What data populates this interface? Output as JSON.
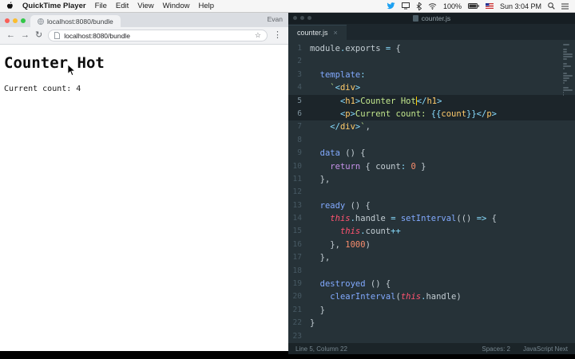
{
  "menu_bar": {
    "app_name": "QuickTime Player",
    "menus": [
      "File",
      "Edit",
      "View",
      "Window",
      "Help"
    ],
    "status": {
      "battery_percent": "100%",
      "clock": "Sun 3:04 PM"
    }
  },
  "browser": {
    "tab_title": "localhost:8080/bundle",
    "profile_name": "Evan",
    "url": "localhost:8080/bundle",
    "page": {
      "heading": "Counter Hot",
      "count_text": "Current count: 4"
    }
  },
  "editor": {
    "window_title": "counter.js",
    "tab": {
      "title": "counter.js"
    },
    "status_bar": {
      "position": "Line 5, Column 22",
      "indent": "Spaces: 2",
      "syntax": "JavaScript Next"
    },
    "code": {
      "lines": [
        {
          "n": 1,
          "hl": false,
          "t": [
            [
              "pl",
              "module"
            ],
            [
              "pn",
              "."
            ],
            [
              "pl",
              "exports "
            ],
            [
              "pn",
              "="
            ],
            [
              "pl",
              " {"
            ]
          ]
        },
        {
          "n": 2,
          "hl": false,
          "t": []
        },
        {
          "n": 3,
          "hl": false,
          "t": [
            [
              "fn",
              "  template"
            ],
            [
              "pn",
              ":"
            ]
          ]
        },
        {
          "n": 4,
          "hl": false,
          "t": [
            [
              "str",
              "    `"
            ],
            [
              "pn",
              "<"
            ],
            [
              "tag",
              "div"
            ],
            [
              "pn",
              ">"
            ]
          ]
        },
        {
          "n": 5,
          "hl": true,
          "t": [
            [
              "str",
              "      "
            ],
            [
              "pn",
              "<"
            ],
            [
              "tag",
              "h1"
            ],
            [
              "pn",
              ">"
            ],
            [
              "str",
              "Counter Hot"
            ],
            [
              "crt",
              ""
            ],
            [
              "pn",
              "</"
            ],
            [
              "tag",
              "h1"
            ],
            [
              "pn",
              ">"
            ]
          ]
        },
        {
          "n": 6,
          "hl": true,
          "t": [
            [
              "str",
              "      "
            ],
            [
              "pn",
              "<"
            ],
            [
              "tag",
              "p"
            ],
            [
              "pn",
              ">"
            ],
            [
              "str",
              "Current count: "
            ],
            [
              "pn",
              "{{"
            ],
            [
              "tag",
              "count"
            ],
            [
              "pn",
              "}}"
            ],
            [
              "pn",
              "</"
            ],
            [
              "tag",
              "p"
            ],
            [
              "pn",
              ">"
            ]
          ]
        },
        {
          "n": 7,
          "hl": false,
          "t": [
            [
              "str",
              "    "
            ],
            [
              "pn",
              "</"
            ],
            [
              "tag",
              "div"
            ],
            [
              "pn",
              ">"
            ],
            [
              "str",
              "`"
            ],
            [
              "pl",
              ","
            ]
          ]
        },
        {
          "n": 8,
          "hl": false,
          "t": []
        },
        {
          "n": 9,
          "hl": false,
          "t": [
            [
              "fn",
              "  data"
            ],
            [
              "pl",
              " () {"
            ]
          ]
        },
        {
          "n": 10,
          "hl": false,
          "t": [
            [
              "pl",
              "    "
            ],
            [
              "kw",
              "return"
            ],
            [
              "pl",
              " { count"
            ],
            [
              "pn",
              ":"
            ],
            [
              "pl",
              " "
            ],
            [
              "num",
              "0"
            ],
            [
              "pl",
              " }"
            ]
          ]
        },
        {
          "n": 11,
          "hl": false,
          "t": [
            [
              "pl",
              "  },"
            ]
          ]
        },
        {
          "n": 12,
          "hl": false,
          "t": []
        },
        {
          "n": 13,
          "hl": false,
          "t": [
            [
              "fn",
              "  ready"
            ],
            [
              "pl",
              " () {"
            ]
          ]
        },
        {
          "n": 14,
          "hl": false,
          "t": [
            [
              "pl",
              "    "
            ],
            [
              "ths",
              "this"
            ],
            [
              "pn",
              "."
            ],
            [
              "pl",
              "handle "
            ],
            [
              "pn",
              "="
            ],
            [
              "pl",
              " "
            ],
            [
              "fn",
              "setInterval"
            ],
            [
              "pl",
              "(() "
            ],
            [
              "pn",
              "=>"
            ],
            [
              "pl",
              " {"
            ]
          ]
        },
        {
          "n": 15,
          "hl": false,
          "t": [
            [
              "pl",
              "      "
            ],
            [
              "ths",
              "this"
            ],
            [
              "pn",
              "."
            ],
            [
              "pl",
              "count"
            ],
            [
              "pn",
              "++"
            ]
          ]
        },
        {
          "n": 16,
          "hl": false,
          "t": [
            [
              "pl",
              "    }, "
            ],
            [
              "num",
              "1000"
            ],
            [
              "pl",
              ")"
            ]
          ]
        },
        {
          "n": 17,
          "hl": false,
          "t": [
            [
              "pl",
              "  },"
            ]
          ]
        },
        {
          "n": 18,
          "hl": false,
          "t": []
        },
        {
          "n": 19,
          "hl": false,
          "t": [
            [
              "fn",
              "  destroyed"
            ],
            [
              "pl",
              " () {"
            ]
          ]
        },
        {
          "n": 20,
          "hl": false,
          "t": [
            [
              "pl",
              "    "
            ],
            [
              "fn",
              "clearInterval"
            ],
            [
              "pl",
              "("
            ],
            [
              "ths",
              "this"
            ],
            [
              "pn",
              "."
            ],
            [
              "pl",
              "handle)"
            ]
          ]
        },
        {
          "n": 21,
          "hl": false,
          "t": [
            [
              "pl",
              "  }"
            ]
          ]
        },
        {
          "n": 22,
          "hl": false,
          "t": [
            [
              "pl",
              "}"
            ]
          ]
        },
        {
          "n": 23,
          "hl": false,
          "t": []
        }
      ]
    }
  },
  "icons": {
    "back": "←",
    "forward": "→",
    "refresh": "↻",
    "star": "☆",
    "more": "⋮",
    "close": "×"
  },
  "colors": {
    "editor_bg": "#263238",
    "string_green": "#C3E88D",
    "tag_yellow": "#FFCB6B",
    "function_blue": "#82AAFF",
    "keyword_purple": "#C792EA",
    "number_orange": "#F78C6C",
    "this_red": "#FF5370",
    "operator_cyan": "#89DDFF",
    "twitter_blue": "#1DA1F2"
  }
}
